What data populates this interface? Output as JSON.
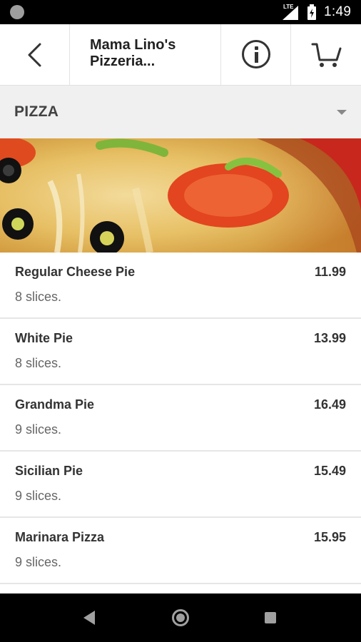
{
  "status_bar": {
    "network_label": "LTE",
    "time": "1:49",
    "icons": [
      "notification-icon",
      "signal-icon",
      "battery-icon"
    ]
  },
  "header": {
    "title": "Mama Lino's Pizzeria...",
    "icons": [
      "back-arrow-icon",
      "info-icon",
      "cart-icon"
    ]
  },
  "category": {
    "label": "PIZZA",
    "icon": "dropdown-caret-icon"
  },
  "banner": {
    "image": "pizza-photo"
  },
  "menu": {
    "items": [
      {
        "name": "Regular Cheese Pie",
        "price": "11.99",
        "description": "8 slices."
      },
      {
        "name": "White Pie",
        "price": "13.99",
        "description": "8 slices."
      },
      {
        "name": "Grandma Pie",
        "price": "16.49",
        "description": "9 slices."
      },
      {
        "name": "Sicilian Pie",
        "price": "15.49",
        "description": "9 slices."
      },
      {
        "name": "Marinara Pizza",
        "price": "15.95",
        "description": "9 slices."
      }
    ]
  },
  "nav_bar": {
    "icons": [
      "nav-back-icon",
      "nav-home-icon",
      "nav-recents-icon"
    ]
  },
  "colors": {
    "header_background": "#ffffff",
    "category_background": "#f0f0f0",
    "divider": "#e6e6e6",
    "text_primary": "#333333",
    "text_secondary": "#666666"
  }
}
